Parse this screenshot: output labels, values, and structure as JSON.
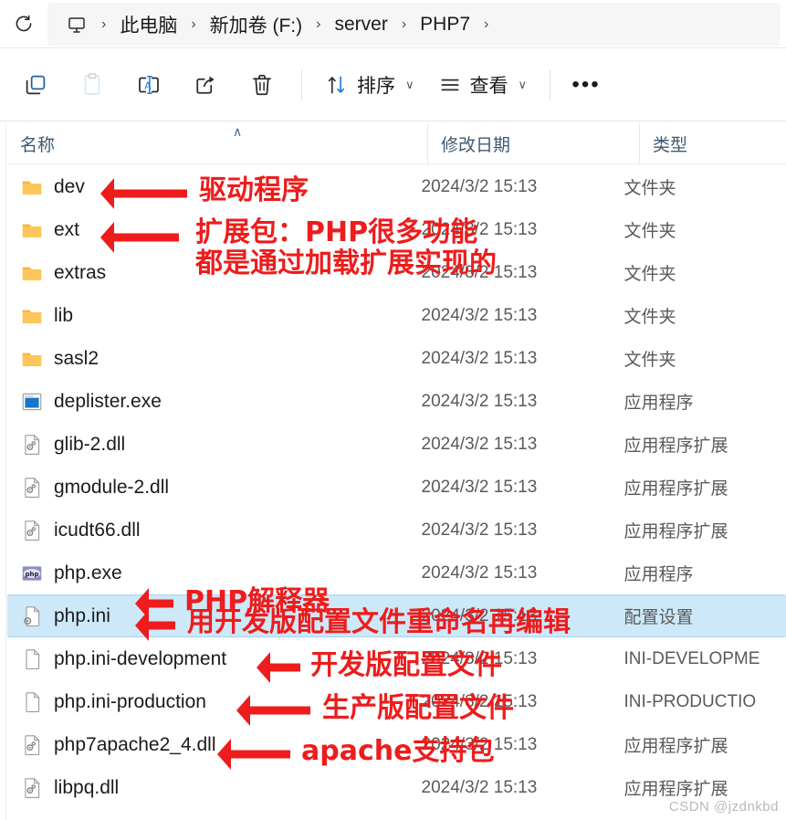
{
  "window": {
    "refresh_icon": "refresh-icon"
  },
  "breadcrumb": {
    "pc_icon": "this-pc-monitor-icon",
    "separator": "›",
    "items": [
      {
        "label": "此电脑"
      },
      {
        "label": "新加卷 (F:)"
      },
      {
        "label": "server"
      },
      {
        "label": "PHP7"
      }
    ]
  },
  "toolbar": {
    "buttons": [
      {
        "name": "copy-button",
        "icon": "copy-icon",
        "enabled": true
      },
      {
        "name": "paste-button",
        "icon": "paste-icon",
        "enabled": false
      },
      {
        "name": "rename-button",
        "icon": "rename-icon",
        "enabled": true
      },
      {
        "name": "share-button",
        "icon": "share-icon",
        "enabled": true
      },
      {
        "name": "delete-button",
        "icon": "trash-icon",
        "enabled": true
      }
    ],
    "sort_label": "排序",
    "view_label": "查看",
    "more_label": "•••",
    "caret": "∨"
  },
  "columns": {
    "name": "名称",
    "date": "修改日期",
    "type": "类型",
    "sort_direction_glyph": "∧"
  },
  "files": [
    {
      "name": "dev",
      "date": "2024/3/2 15:13",
      "type": "文件夹",
      "icon": "folder-icon",
      "selected": false
    },
    {
      "name": "ext",
      "date": "2024/3/2 15:13",
      "type": "文件夹",
      "icon": "folder-icon",
      "selected": false
    },
    {
      "name": "extras",
      "date": "2024/3/2 15:13",
      "type": "文件夹",
      "icon": "folder-icon",
      "selected": false
    },
    {
      "name": "lib",
      "date": "2024/3/2 15:13",
      "type": "文件夹",
      "icon": "folder-icon",
      "selected": false
    },
    {
      "name": "sasl2",
      "date": "2024/3/2 15:13",
      "type": "文件夹",
      "icon": "folder-icon",
      "selected": false
    },
    {
      "name": "deplister.exe",
      "date": "2024/3/2 15:13",
      "type": "应用程序",
      "icon": "exe-icon",
      "selected": false
    },
    {
      "name": "glib-2.dll",
      "date": "2024/3/2 15:13",
      "type": "应用程序扩展",
      "icon": "dll-icon",
      "selected": false
    },
    {
      "name": "gmodule-2.dll",
      "date": "2024/3/2 15:13",
      "type": "应用程序扩展",
      "icon": "dll-icon",
      "selected": false
    },
    {
      "name": "icudt66.dll",
      "date": "2024/3/2 15:13",
      "type": "应用程序扩展",
      "icon": "dll-icon",
      "selected": false
    },
    {
      "name": "php.exe",
      "date": "2024/3/2 15:13",
      "type": "应用程序",
      "icon": "php-exe-icon",
      "selected": false
    },
    {
      "name": "php.ini",
      "date": "2024/3/2 15:13",
      "type": "配置设置",
      "icon": "ini-icon",
      "selected": true
    },
    {
      "name": "php.ini-development",
      "date": "2024/3/2 15:13",
      "type": "INI-DEVELOPME",
      "icon": "blank-file-icon",
      "selected": false
    },
    {
      "name": "php.ini-production",
      "date": "2024/3/2 15:13",
      "type": "INI-PRODUCTIO",
      "icon": "blank-file-icon",
      "selected": false
    },
    {
      "name": "php7apache2_4.dll",
      "date": "2024/3/2 15:13",
      "type": "应用程序扩展",
      "icon": "dll-icon",
      "selected": false
    },
    {
      "name": "libpq.dll",
      "date": "2024/3/2 15:13",
      "type": "应用程序扩展",
      "icon": "dll-icon",
      "selected": false
    }
  ],
  "annotations": {
    "color": "#ee1c1c",
    "items": [
      {
        "text": "驱动程序",
        "target": "dev"
      },
      {
        "text": "扩展包：PHP很多功能\n都是通过加载扩展实现的",
        "target": "ext"
      },
      {
        "text": "PHP解释器",
        "target": "php.exe"
      },
      {
        "text": "用开发版配置文件重命名再编辑",
        "target": "php.ini"
      },
      {
        "text": "开发版配置文件",
        "target": "php.ini-development"
      },
      {
        "text": "生产版配置文件",
        "target": "php.ini-production"
      },
      {
        "text": "apache支持包",
        "target": "php7apache2_4.dll"
      }
    ]
  },
  "watermark": "CSDN @jzdnkbd"
}
